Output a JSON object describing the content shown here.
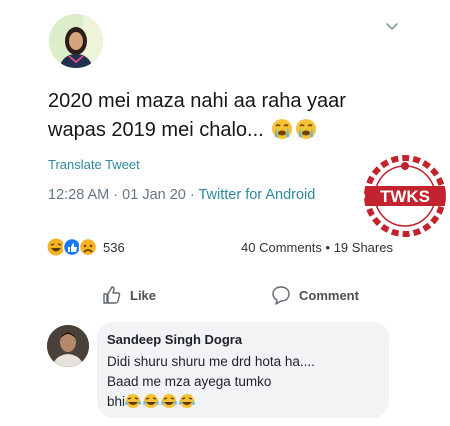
{
  "tweet": {
    "text_line1": "2020 mei maza nahi aa raha yaar",
    "text_line2": "wapas 2019 mei chalo...",
    "emoji_names": [
      "crying-face-icon",
      "crying-face-icon"
    ],
    "translate_label": "Translate Tweet",
    "time": "12:28 AM",
    "date": "01 Jan 20",
    "source": "Twitter for Android",
    "separator": " · "
  },
  "watermark": {
    "text": "TWKS"
  },
  "reactions": {
    "icons": [
      "laugh-react-icon",
      "like-react-icon",
      "sad-react-icon"
    ],
    "count": "536"
  },
  "stats": {
    "comments": "40 Comments",
    "dot": " • ",
    "shares": "19 Shares"
  },
  "actions": {
    "like_label": "Like",
    "comment_label": "Comment"
  },
  "comment": {
    "author": "Sandeep Singh Dogra",
    "line1": "Didi shuru shuru me drd hota ha....",
    "line2": "Baad me mza ayega tumko",
    "line3": "bhi",
    "emojis": [
      "laughing-crying-icon",
      "laughing-crying-icon",
      "laughing-crying-icon",
      "laughing-crying-icon"
    ]
  },
  "colors": {
    "text": "#14171a",
    "muted": "#657786",
    "link": "#2d8a9c",
    "watermark": "#c2232e",
    "bubble": "#f2f3f5"
  }
}
